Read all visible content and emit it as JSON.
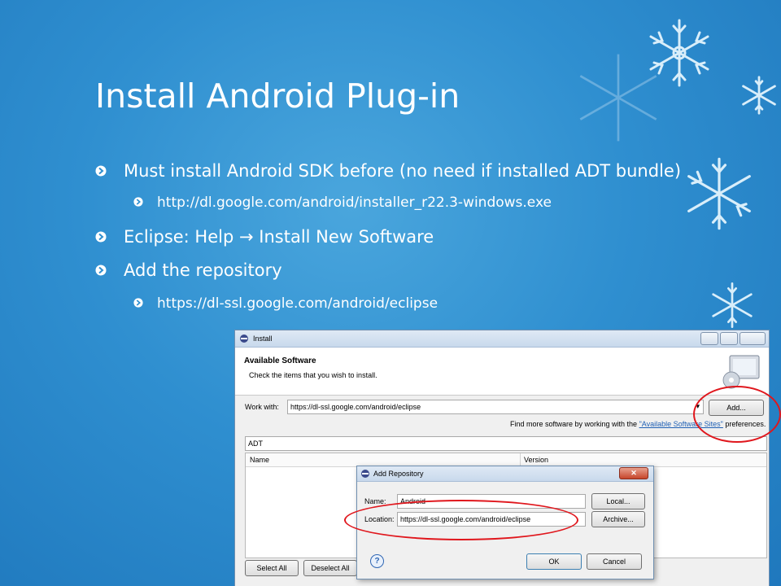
{
  "slide": {
    "title": "Install Android Plug-in",
    "bullets": [
      {
        "level": 1,
        "text": "Must install Android SDK before (no need if installed ADT bundle)"
      },
      {
        "level": 2,
        "text": "http://dl.google.com/android/installer_r22.3-windows.exe"
      },
      {
        "level": 1,
        "text": "Eclipse: Help  Install New Software"
      },
      {
        "level": 1,
        "text": "Add the repository"
      },
      {
        "level": 2,
        "text": "https://dl-ssl.google.com/android/eclipse"
      }
    ],
    "arrow_glyph": "→",
    "eclipse_help_prefix": "Eclipse: Help ",
    "eclipse_help_suffix": " Install New Software"
  },
  "install_window": {
    "title": "Install",
    "header_title": "Available Software",
    "header_subtitle": "Check the items that you wish to install.",
    "work_with_label": "Work with:",
    "work_with_value": "https://dl-ssl.google.com/android/eclipse",
    "add_button": "Add...",
    "find_more_prefix": "Find more software by working with the ",
    "find_more_link": "\"Available Software Sites\"",
    "find_more_suffix": " preferences.",
    "filter_value": "ADT",
    "columns": [
      "Name",
      "Version"
    ],
    "select_all_button": "Select All",
    "deselect_all_button": "Deselect All"
  },
  "repo_dialog": {
    "title": "Add Repository",
    "name_label": "Name:",
    "name_value": "Android",
    "location_label": "Location:",
    "location_value": "https://dl-ssl.google.com/android/eclipse",
    "local_button": "Local...",
    "archive_button": "Archive...",
    "ok_button": "OK",
    "cancel_button": "Cancel",
    "close_glyph": "✕",
    "help_glyph": "?"
  },
  "colors": {
    "background": "#2f8fd0",
    "text": "#ffffff",
    "highlight_ring": "#e0171d",
    "link": "#1e5fb4"
  }
}
